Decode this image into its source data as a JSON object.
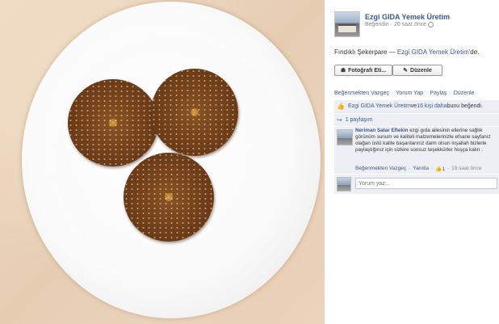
{
  "post": {
    "page_name": "Ezgi GIDA Yemek Üretim",
    "like_label": "Beğendin",
    "time_ago": "20 saat önce",
    "caption_title": "Fındıklı Şekerpare",
    "caption_sep": " — ",
    "caption_page": "Ezgi GIDA Yemek Üretim",
    "caption_suffix": "'de.",
    "tag_button": "Fotoğrafı Eti...",
    "edit_button": "Düzenle"
  },
  "actions": {
    "unlike": "Beğenmekten Vazgeç",
    "comment": "Yorum Yap",
    "share": "Paylaş",
    "edit": "Düzenle",
    "sep": "·"
  },
  "ufi": {
    "likes_name": "Ezgi GIDA Yemek Üretim",
    "likes_and": " ve ",
    "likes_others": "16 kişi daha",
    "likes_suffix": " bunu beğendi.",
    "shares": "1 paylaşım"
  },
  "comment": {
    "author": "Neriman Satar Eftekin",
    "text": " ezgi gıda ailesinin ellerine sağlık görünüm sunum ve kaliteli malzemelerinizle efsane sayfanız olağan üstü kalite başarılarınız daim olsun inşallah bizlerle paylaştığınız için sizlere sonsuz teşekkürler hoşça kalın .",
    "unlike": "Beğenmekten Vazgeç",
    "reply": "Yanıtla",
    "like_count": "1",
    "time": "19 saat önce"
  },
  "reply": {
    "placeholder": "Yorum yaz..."
  },
  "icons": {
    "globe": "globe-icon",
    "tag": "tag-icon",
    "pencil": "pencil-icon",
    "like": "thumbs-up-icon",
    "share": "share-icon"
  },
  "colors": {
    "link": "#3b5998",
    "ufi_bg": "#edeff4"
  }
}
